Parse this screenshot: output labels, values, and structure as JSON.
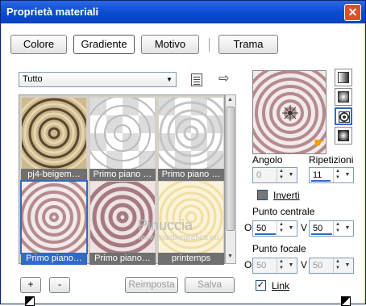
{
  "window": {
    "title": "Proprietà materiali",
    "close_glyph": "✕"
  },
  "tabs": [
    {
      "label": "Colore",
      "selected": false
    },
    {
      "label": "Gradiente",
      "selected": true
    },
    {
      "label": "Motivo",
      "selected": false
    },
    {
      "label": "Trama",
      "selected": false
    }
  ],
  "filter": {
    "value": "Tutto"
  },
  "gallery": {
    "items": [
      {
        "label": "pj4-beigem…",
        "selected": false
      },
      {
        "label": "Primo piano …",
        "selected": false
      },
      {
        "label": "Primo piano …",
        "selected": false
      },
      {
        "label": "Primo piano…",
        "selected": true
      },
      {
        "label": "Primo piano…",
        "selected": false
      },
      {
        "label": "printemps",
        "selected": false
      }
    ]
  },
  "buttons": {
    "add": "+",
    "remove": "-",
    "reset": "Reimposta",
    "save": "Salva"
  },
  "watermark": {
    "line1": "Pinuccia",
    "line2": "www.maidiregrafica.eu"
  },
  "properties": {
    "angle_label": "Angolo",
    "angle_value": "0",
    "repeats_label": "Ripetizioni",
    "repeats_value": "11",
    "invert_label": "Inverti",
    "center_label": "Punto centrale",
    "center_h_prefix": "O",
    "center_h": "50",
    "center_v_prefix": "V",
    "center_v": "50",
    "focal_label": "Punto focale",
    "focal_h_prefix": "O",
    "focal_h": "50",
    "focal_v_prefix": "V",
    "focal_v": "50",
    "link_label": "Link",
    "link_checked": true
  },
  "colors": {
    "titlebar": "#0a4ad0",
    "selection": "#316ac5",
    "ring_a": "#b58a8f",
    "ring_b": "#f2eaea"
  }
}
